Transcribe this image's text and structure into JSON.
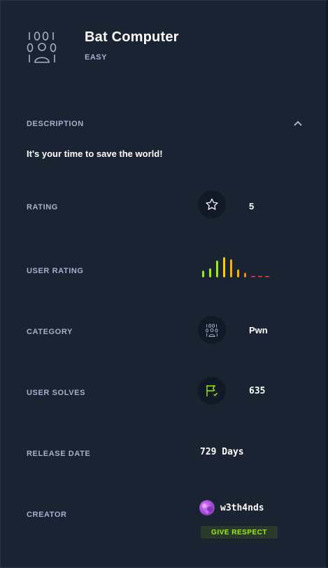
{
  "challenge": {
    "title": "Bat Computer",
    "difficulty": "EASY",
    "icon": "binary-user-icon"
  },
  "description": {
    "label": "DESCRIPTION",
    "text": "It's your time to save the world!",
    "toggle_icon": "chevron-up-icon"
  },
  "rating": {
    "label": "RATING",
    "icon": "star-icon",
    "value": "5"
  },
  "user_rating": {
    "label": "USER RATING",
    "bar_levels": [
      0.3,
      0.4,
      0.75,
      0.9,
      0.8,
      0.35,
      0.2,
      0.05,
      0.05,
      0.05
    ],
    "bar_colors": [
      "#9fef00",
      "#9fef00",
      "#9fef00",
      "#ffcc00",
      "#ffaf00",
      "#ffaf00",
      "#ff8c00",
      "#ff3e3e",
      "#ff3e3e",
      "#ff3e3e"
    ]
  },
  "category": {
    "label": "CATEGORY",
    "icon": "binary-user-icon",
    "value": "Pwn"
  },
  "user_solves": {
    "label": "USER SOLVES",
    "icon": "flag-check-icon",
    "value": "635"
  },
  "release_date": {
    "label": "RELEASE DATE",
    "value": "729 Days"
  },
  "creator": {
    "label": "CREATOR",
    "name": "w3th4nds",
    "respect_label": "GIVE RESPECT"
  },
  "colors": {
    "background": "#1a2332",
    "label": "#a4b1cd",
    "accent_green": "#9fef00"
  }
}
